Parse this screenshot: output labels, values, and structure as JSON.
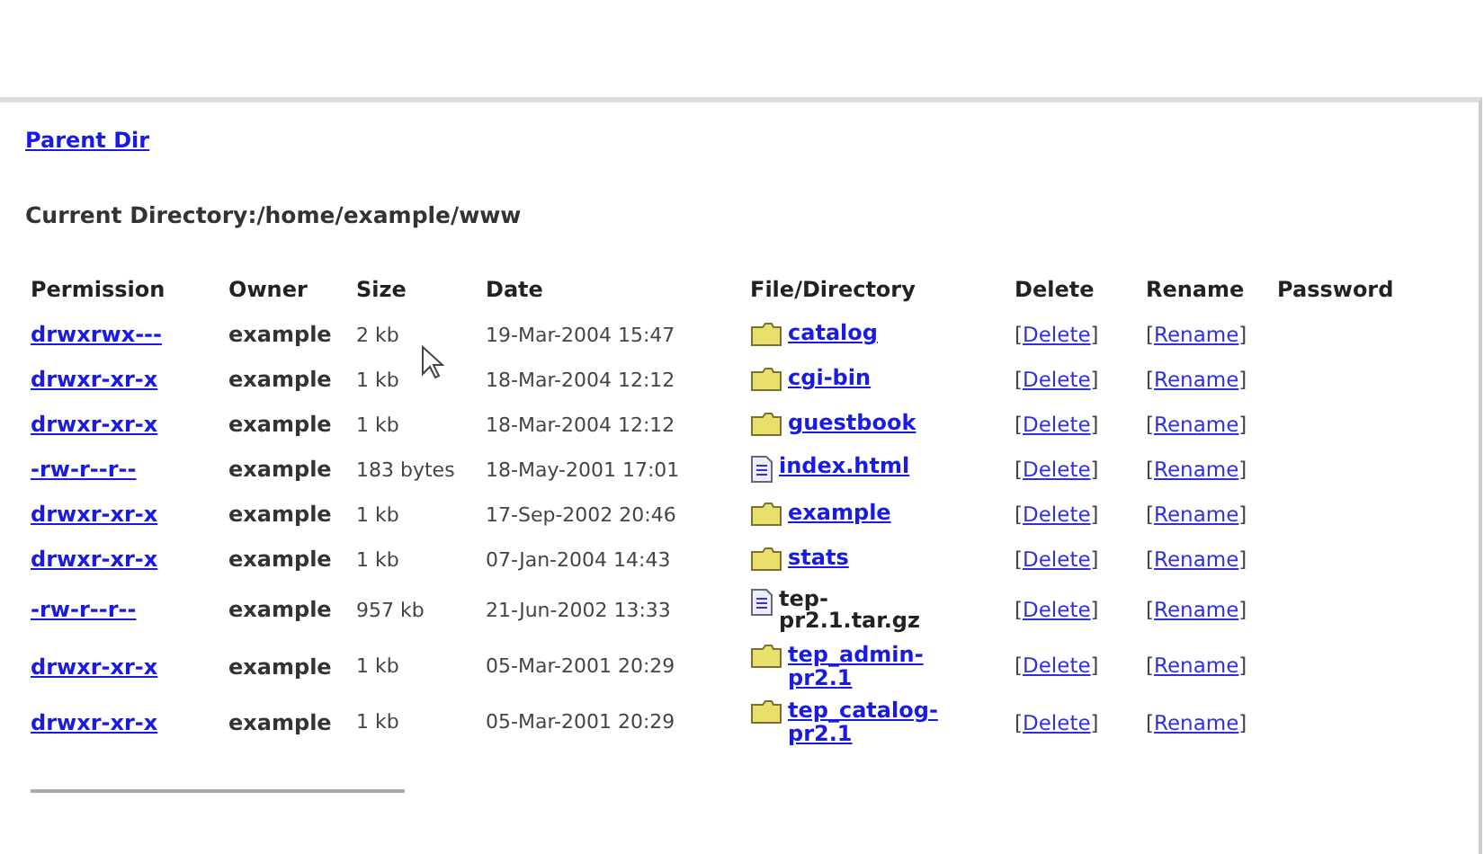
{
  "parent_link": "Parent Dir",
  "current_directory": "Current Directory:/home/example/www",
  "table": {
    "columns": [
      "Permission",
      "Owner",
      "Size",
      "Date",
      "File/Directory",
      "Delete",
      "Rename",
      "Password"
    ],
    "rows": [
      {
        "permission": "drwxrwx---",
        "owner": "example",
        "size": "2 kb",
        "date": "19-Mar-2004 15:47",
        "kind": "folder",
        "name": "catalog",
        "link": true,
        "delete": [
          "[",
          "Delete",
          "]"
        ],
        "rename": [
          "[",
          "Rename",
          "]"
        ]
      },
      {
        "permission": "drwxr-xr-x",
        "owner": "example",
        "size": "1 kb",
        "date": "18-Mar-2004 12:12",
        "kind": "folder",
        "name": "cgi-bin",
        "link": true,
        "delete": [
          "[",
          "Delete",
          "]"
        ],
        "rename": [
          "[",
          "Rename",
          "]"
        ]
      },
      {
        "permission": "drwxr-xr-x",
        "owner": "example",
        "size": "1 kb",
        "date": "18-Mar-2004 12:12",
        "kind": "folder",
        "name": "guestbook",
        "link": true,
        "delete": [
          "[",
          "Delete",
          "]"
        ],
        "rename": [
          "[",
          "Rename",
          "]"
        ]
      },
      {
        "permission": "-rw-r--r--",
        "owner": "example",
        "size": "183 bytes",
        "date": "18-May-2001 17:01",
        "kind": "file",
        "name": "index.html",
        "link": true,
        "delete": [
          "[",
          "Delete",
          "]"
        ],
        "rename": [
          "[",
          "Rename",
          "]"
        ]
      },
      {
        "permission": "drwxr-xr-x",
        "owner": "example",
        "size": "1 kb",
        "date": "17-Sep-2002 20:46",
        "kind": "folder",
        "name": "example",
        "link": true,
        "delete": [
          "[",
          "Delete",
          "]"
        ],
        "rename": [
          "[",
          "Rename",
          "]"
        ]
      },
      {
        "permission": "drwxr-xr-x",
        "owner": "example",
        "size": "1 kb",
        "date": "07-Jan-2004 14:43",
        "kind": "folder",
        "name": "stats",
        "link": true,
        "delete": [
          "[",
          "Delete",
          "]"
        ],
        "rename": [
          "[",
          "Rename",
          "]"
        ]
      },
      {
        "permission": "-rw-r--r--",
        "owner": "example",
        "size": "957 kb",
        "date": "21-Jun-2002 13:33",
        "kind": "file",
        "name": "tep-pr2.1.tar.gz",
        "link": false,
        "delete": [
          "[",
          "Delete",
          "]"
        ],
        "rename": [
          "[",
          "Rename",
          "]"
        ]
      },
      {
        "permission": "drwxr-xr-x",
        "owner": "example",
        "size": "1 kb",
        "date": "05-Mar-2001 20:29",
        "kind": "folder",
        "name": "tep_admin-pr2.1",
        "link": true,
        "delete": [
          "[",
          "Delete",
          "]"
        ],
        "rename": [
          "[",
          "Rename",
          "]"
        ]
      },
      {
        "permission": "drwxr-xr-x",
        "owner": "example",
        "size": "1 kb",
        "date": "05-Mar-2001 20:29",
        "kind": "folder",
        "name": "tep_catalog-pr2.1",
        "link": true,
        "delete": [
          "[",
          "Delete",
          "]"
        ],
        "rename": [
          "[",
          "Rename",
          "]"
        ]
      }
    ]
  }
}
